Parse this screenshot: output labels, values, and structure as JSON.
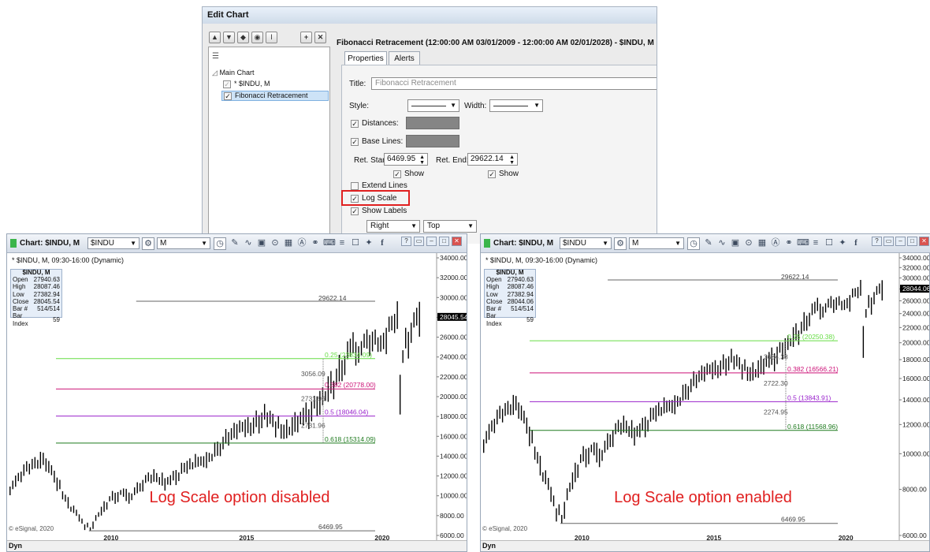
{
  "dialog": {
    "title": "Edit Chart",
    "header": "Fibonacci Retracement (12:00:00 AM 03/01/2009 - 12:00:00 AM 02/01/2028) - $INDU, M",
    "toolbar_icons": [
      "arrow-up-icon",
      "arrow-down-icon",
      "move-icon",
      "eye-icon",
      "text-icon",
      "add-icon",
      "delete-icon"
    ],
    "tree": {
      "root": "Main Chart",
      "items": [
        {
          "label": "* $INDU, M",
          "checked": true
        },
        {
          "label": "Fibonacci Retracement",
          "checked": true
        }
      ]
    },
    "tabs": [
      "Properties",
      "Alerts"
    ],
    "title_label": "Title:",
    "title_placeholder": "Fibonacci Retracement",
    "style_label": "Style:",
    "width_label": "Width:",
    "distances_label": "Distances:",
    "baselines_label": "Base Lines:",
    "ret_start_label": "Ret. Start:",
    "ret_start_value": "6469.95",
    "ret_end_label": "Ret. End:",
    "ret_end_value": "29622.14",
    "show_label": "Show",
    "extend_lines_label": "Extend Lines",
    "log_scale_label": "Log Scale",
    "show_labels_label": "Show Labels",
    "h_align": "Right",
    "v_align": "Top",
    "highlight_color": "#e02020"
  },
  "windows": [
    {
      "title": "Chart: $INDU, M",
      "symbol": "$INDU",
      "interval": "M",
      "subtitle": "* $INDU, M, 09:30-16:00 (Dynamic)",
      "info": {
        "header": "$INDU, M",
        "rows": [
          [
            "Open",
            "27940.63"
          ],
          [
            "High",
            "28087.46"
          ],
          [
            "Low",
            "27382.94"
          ],
          [
            "Close",
            "28045.54"
          ],
          [
            "Bar #",
            "514/514"
          ],
          [
            "Bar Index",
            "59"
          ]
        ]
      },
      "last_price": "28045.54",
      "caption": "Log Scale option disabled",
      "copyright": "© eSignal, 2020",
      "status": "Dyn",
      "x_labels": [
        "2010",
        "2015",
        "2020"
      ],
      "y_labels": [
        "34000.00",
        "32000.00",
        "30000.00",
        "28000.00",
        "26000.00",
        "24000.00",
        "22000.00",
        "20000.00",
        "18000.00",
        "16000.00",
        "14000.00",
        "12000.00",
        "10000.00",
        "8000.00",
        "6000.00"
      ],
      "fib_top": "29622.14",
      "fib_bottom": "6469.95",
      "fib_levels": [
        {
          "label": "0.25 (23834.09)",
          "color": "#66dd44"
        },
        {
          "label": "0.382 (20778.00)",
          "color": "#cc1177"
        },
        {
          "label": "0.5 (18046.04)",
          "color": "#9922cc"
        },
        {
          "label": "0.618 (15314.09)",
          "color": "#1e7a1e"
        }
      ],
      "distances": [
        "3056.09",
        "2731.96",
        "2731.96"
      ]
    },
    {
      "title": "Chart: $INDU, M",
      "symbol": "$INDU",
      "interval": "M",
      "subtitle": "* $INDU, M, 09:30-16:00 (Dynamic)",
      "info": {
        "header": "$INDU, M",
        "rows": [
          [
            "Open",
            "27940.63"
          ],
          [
            "High",
            "28087.46"
          ],
          [
            "Low",
            "27382.94"
          ],
          [
            "Close",
            "28044.06"
          ],
          [
            "Bar #",
            "514/514"
          ],
          [
            "Bar Index",
            "59"
          ]
        ]
      },
      "last_price": "28044.06",
      "caption": "Log Scale option enabled",
      "copyright": "© eSignal, 2020",
      "status": "Dyn",
      "x_labels": [
        "2010",
        "2015",
        "2020"
      ],
      "y_labels": [
        "34000.00",
        "32000.00",
        "30000.00",
        "28000.00",
        "26000.00",
        "24000.00",
        "22000.00",
        "20000.00",
        "18000.00",
        "16000.00",
        "14000.00",
        "12000.00",
        "10000.00",
        "8000.00",
        "6000.00"
      ],
      "fib_top": "29622.14",
      "fib_bottom": "6469.95",
      "fib_levels": [
        {
          "label": "0.25 (20250.38)",
          "color": "#66dd44"
        },
        {
          "label": "0.382 (16566.21)",
          "color": "#cc1177"
        },
        {
          "label": "0.5 (13843.91)",
          "color": "#9922cc"
        },
        {
          "label": "0.618 (11568.96)",
          "color": "#1e7a1e"
        }
      ],
      "distances": [
        "3684.38",
        "2722.30",
        "2274.95"
      ]
    }
  ]
}
